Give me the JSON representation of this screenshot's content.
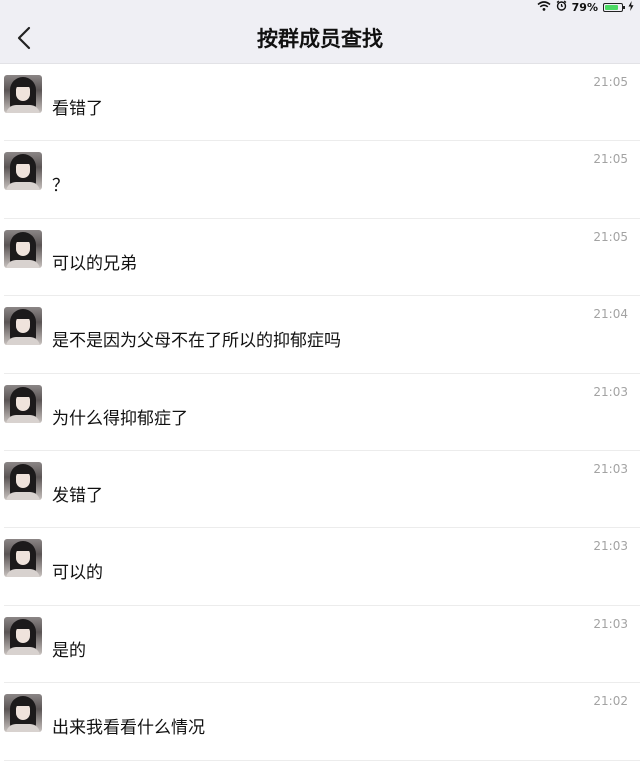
{
  "status_bar": {
    "battery_percent": "79%",
    "battery_level": 0.79,
    "icons": [
      "wifi-icon",
      "alarm-icon",
      "battery-icon",
      "charging-icon"
    ]
  },
  "nav": {
    "back_icon": "chevron-left-icon",
    "title": "按群成员查找"
  },
  "colors": {
    "nav_bg": "#efeff4",
    "battery_green": "#4cd964",
    "time_gray": "#a3a3a3"
  },
  "messages": [
    {
      "text": "看错了",
      "time": "21:05"
    },
    {
      "text": "？",
      "time": "21:05"
    },
    {
      "text": "可以的兄弟",
      "time": "21:05"
    },
    {
      "text": "是不是因为父母不在了所以的抑郁症吗",
      "time": "21:04"
    },
    {
      "text": "为什么得抑郁症了",
      "time": "21:03"
    },
    {
      "text": "发错了",
      "time": "21:03"
    },
    {
      "text": "可以的",
      "time": "21:03"
    },
    {
      "text": "是的",
      "time": "21:03"
    },
    {
      "text": "出来我看看什么情况",
      "time": "21:02"
    }
  ]
}
